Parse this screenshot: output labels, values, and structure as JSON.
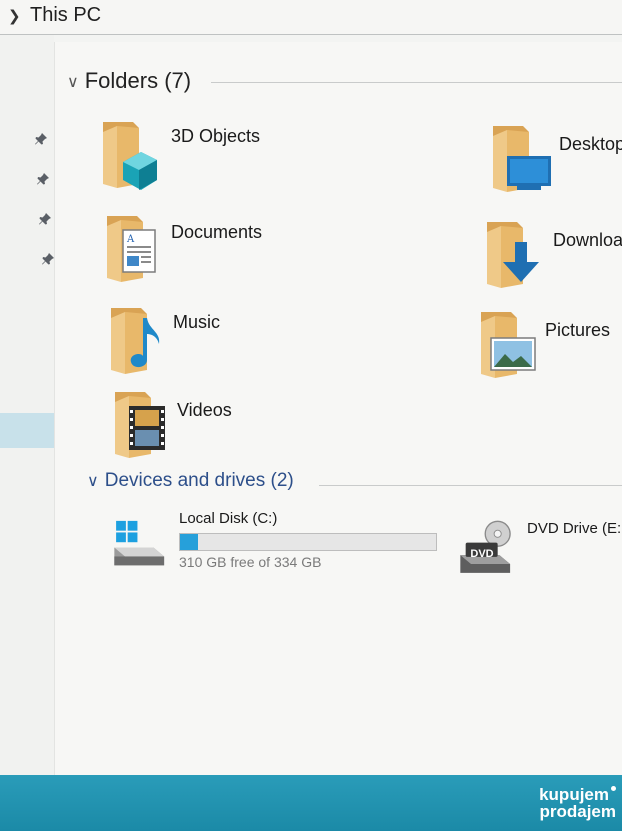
{
  "address_bar": {
    "crumb": "This PC"
  },
  "folders": {
    "title": "Folders (7)",
    "items": [
      {
        "label": "3D Objects",
        "icon": "3d-objects-folder-icon"
      },
      {
        "label": "Desktop",
        "icon": "desktop-folder-icon"
      },
      {
        "label": "Documents",
        "icon": "documents-folder-icon"
      },
      {
        "label": "Downloa",
        "icon": "downloads-folder-icon"
      },
      {
        "label": "Music",
        "icon": "music-folder-icon"
      },
      {
        "label": "Pictures",
        "icon": "pictures-folder-icon"
      },
      {
        "label": "Videos",
        "icon": "videos-folder-icon"
      }
    ]
  },
  "devices": {
    "title": "Devices and drives (2)",
    "drives": [
      {
        "label": "Local Disk (C:)",
        "free_text": "310 GB free of 334 GB",
        "used_fraction": 0.072,
        "icon": "windows-drive-icon"
      },
      {
        "label": "DVD Drive (E:",
        "icon": "dvd-drive-icon",
        "badge": "DVD"
      }
    ]
  },
  "watermark": {
    "line1": "kupujem",
    "line2": "prodajem"
  },
  "colors": {
    "accent": "#26a0da",
    "taskbar": "#1b8aa7",
    "folder": "#e8b86a",
    "nav_selected": "#c8e1ea"
  }
}
